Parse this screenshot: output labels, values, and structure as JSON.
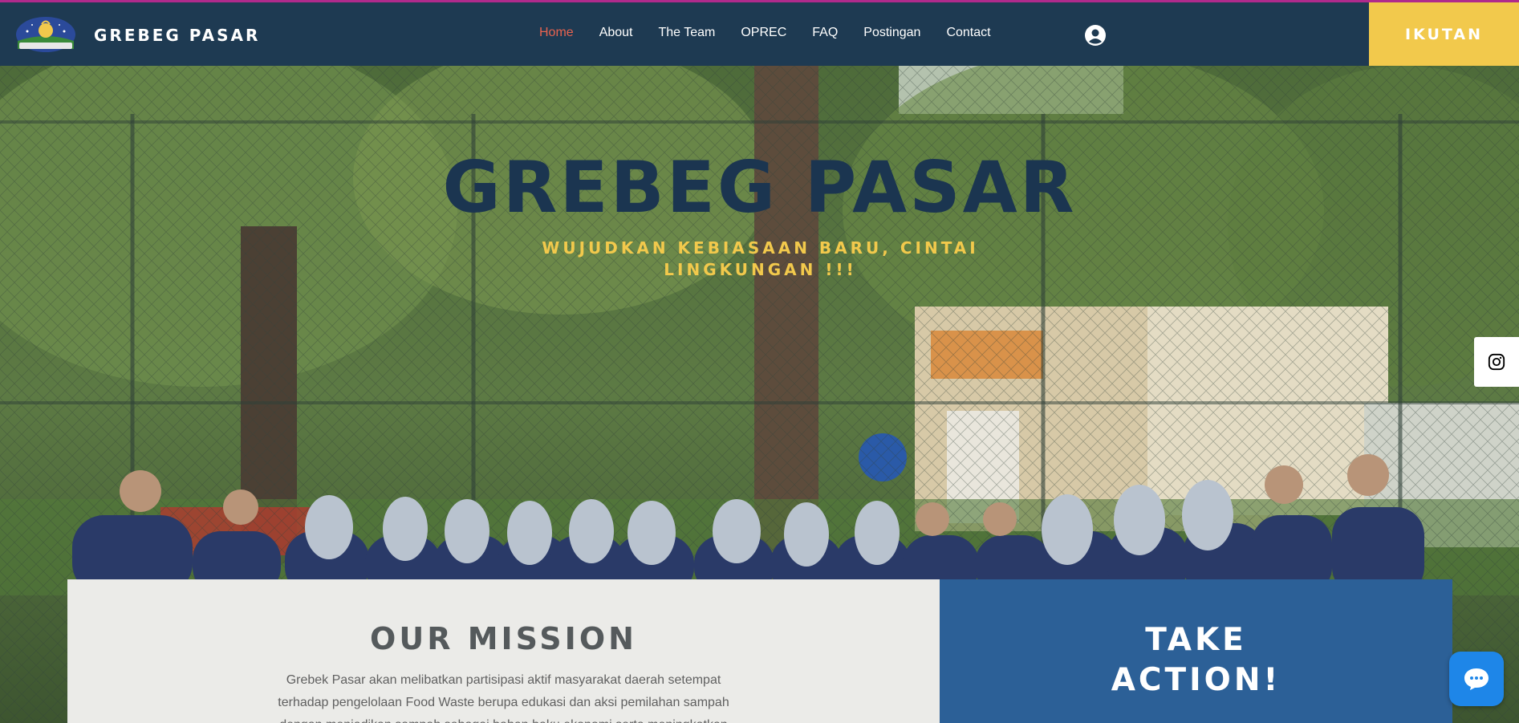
{
  "header": {
    "brand": "GREBEG PASAR",
    "logo_icon": "grebeg-pasar-logo",
    "nav": [
      "Home",
      "About",
      "The Team",
      "OPREC",
      "FAQ",
      "Postingan",
      "Contact"
    ],
    "active_nav": "Home",
    "user_icon": "user-account-icon",
    "cta_label": "IKUTAN"
  },
  "hero": {
    "title": "GREBEG PASAR",
    "subtitle": "WUJUDKAN KEBIASAAN BARU, CINTAI LINGKUNGAN !!!"
  },
  "social": {
    "icon": "instagram-icon"
  },
  "mission": {
    "heading": "OUR MISSION",
    "text": "Grebek Pasar akan melibatkan partisipasi aktif masyarakat daerah setempat terhadap pengelolaan Food Waste berupa edukasi dan aksi pemilahan sampah dengan menjadikan sampah sebagai bahan baku ekonomi serta meningkatkan"
  },
  "action": {
    "heading_line1": "TAKE",
    "heading_line2": "ACTION!"
  },
  "chat": {
    "icon": "chat-bubble-icon"
  },
  "colors": {
    "header_bg": "#1e3a52",
    "cta_bg": "#f2c94c",
    "active_nav": "#e8634f",
    "hero_title": "#1b3550",
    "hero_subtitle": "#f2c94c",
    "mission_bg": "#ebebe8",
    "action_bg": "#2c6097",
    "chat_bg": "#1e86e8"
  }
}
